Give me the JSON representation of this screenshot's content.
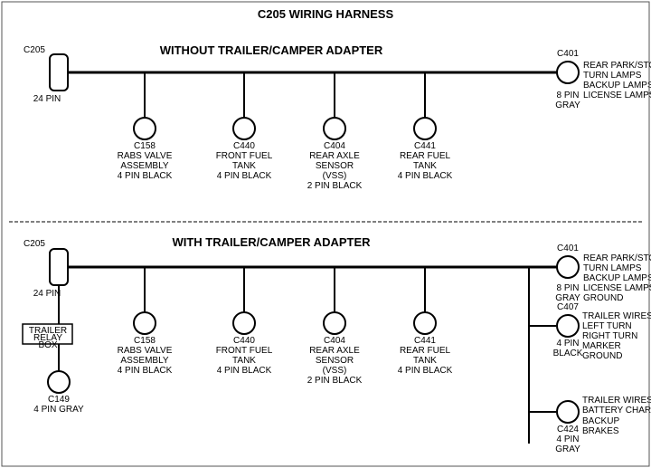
{
  "title": "C205 WIRING HARNESS",
  "top_section": {
    "label": "WITHOUT  TRAILER/CAMPER  ADAPTER",
    "left_connector": {
      "id": "C205",
      "pin": "24 PIN"
    },
    "right_connector": {
      "id": "C401",
      "pin": "8 PIN",
      "color": "GRAY",
      "desc": [
        "REAR PARK/STOP",
        "TURN LAMPS",
        "BACKUP LAMPS",
        "LICENSE LAMPS"
      ]
    },
    "connectors": [
      {
        "id": "C158",
        "lines": [
          "RABS VALVE",
          "ASSEMBLY",
          "4 PIN BLACK"
        ]
      },
      {
        "id": "C440",
        "lines": [
          "FRONT FUEL",
          "TANK",
          "4 PIN BLACK"
        ]
      },
      {
        "id": "C404",
        "lines": [
          "REAR AXLE",
          "SENSOR",
          "(VSS)",
          "2 PIN BLACK"
        ]
      },
      {
        "id": "C441",
        "lines": [
          "REAR FUEL",
          "TANK",
          "4 PIN BLACK"
        ]
      }
    ]
  },
  "bottom_section": {
    "label": "WITH  TRAILER/CAMPER  ADAPTER",
    "left_connector": {
      "id": "C205",
      "pin": "24 PIN"
    },
    "trailer_relay": {
      "label": "TRAILER RELAY BOX",
      "sub_connector": {
        "id": "C149",
        "desc": "4 PIN GRAY"
      }
    },
    "right_connector": {
      "id": "C401",
      "pin": "8 PIN",
      "color": "GRAY",
      "desc": [
        "REAR PARK/STOP",
        "TURN LAMPS",
        "BACKUP LAMPS",
        "LICENSE LAMPS",
        "GROUND"
      ]
    },
    "connectors": [
      {
        "id": "C158",
        "lines": [
          "RABS VALVE",
          "ASSEMBLY",
          "4 PIN BLACK"
        ]
      },
      {
        "id": "C440",
        "lines": [
          "FRONT FUEL",
          "TANK",
          "4 PIN BLACK"
        ]
      },
      {
        "id": "C404",
        "lines": [
          "REAR AXLE",
          "SENSOR",
          "(VSS)",
          "2 PIN BLACK"
        ]
      },
      {
        "id": "C441",
        "lines": [
          "REAR FUEL",
          "TANK",
          "4 PIN BLACK"
        ]
      }
    ],
    "right_branches": [
      {
        "id": "C407",
        "pin": "4 PIN",
        "color": "BLACK",
        "desc": [
          "TRAILER WIRES",
          "LEFT TURN",
          "RIGHT TURN",
          "MARKER",
          "GROUND"
        ]
      },
      {
        "id": "C424",
        "pin": "4 PIN",
        "color": "GRAY",
        "desc": [
          "TRAILER WIRES",
          "BATTERY CHARGE",
          "BACKUP",
          "BRAKES"
        ]
      }
    ]
  }
}
